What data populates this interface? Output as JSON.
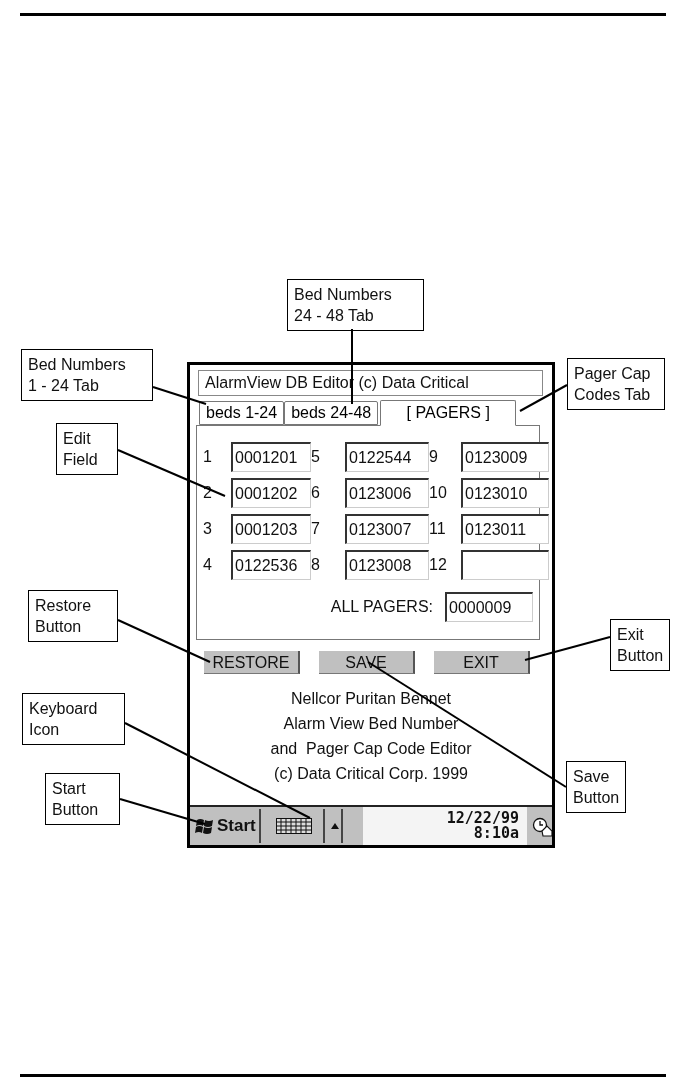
{
  "app": {
    "title": "AlarmView DB Editor (c) Data Critical",
    "tabs": [
      {
        "label": "beds 1-24",
        "selected": false
      },
      {
        "label": "beds 24-48",
        "selected": false
      },
      {
        "label": "[ PAGERS ]",
        "selected": true
      }
    ],
    "pagers": [
      {
        "number": "1",
        "value": "0001201"
      },
      {
        "number": "2",
        "value": "0001202"
      },
      {
        "number": "3",
        "value": "0001203"
      },
      {
        "number": "4",
        "value": "0122536"
      },
      {
        "number": "5",
        "value": "0122544"
      },
      {
        "number": "6",
        "value": "0123006"
      },
      {
        "number": "7",
        "value": "0123007"
      },
      {
        "number": "8",
        "value": "0123008"
      },
      {
        "number": "9",
        "value": "0123009"
      },
      {
        "number": "10",
        "value": "0123010"
      },
      {
        "number": "11",
        "value": "0123011"
      },
      {
        "number": "12"
      }
    ],
    "all_pagers": {
      "label": "ALL PAGERS:",
      "value": "0000009"
    },
    "buttons": [
      "RESTORE",
      "SAVE",
      "EXIT"
    ],
    "about": [
      "Nellcor Puritan Bennet",
      "Alarm View Bed Number",
      "and  Pager Cap Code Editor",
      "(c) Data Critical Corp. 1999"
    ]
  },
  "taskbar": {
    "start": "Start",
    "date": "12/22/99",
    "time": "8:10a"
  },
  "callouts": [
    {
      "text": "Bed Numbers\n24 - 48 Tab"
    },
    {
      "text": "Bed Numbers\n1 - 24 Tab"
    },
    {
      "text": "Edit\nField"
    },
    {
      "text": "Pager Cap\nCodes Tab"
    },
    {
      "text": "Restore\nButton"
    },
    {
      "text": "Exit\nButton"
    },
    {
      "text": "Keyboard\nIcon"
    },
    {
      "text": "Save\nButton"
    },
    {
      "text": "Start\nButton"
    }
  ]
}
